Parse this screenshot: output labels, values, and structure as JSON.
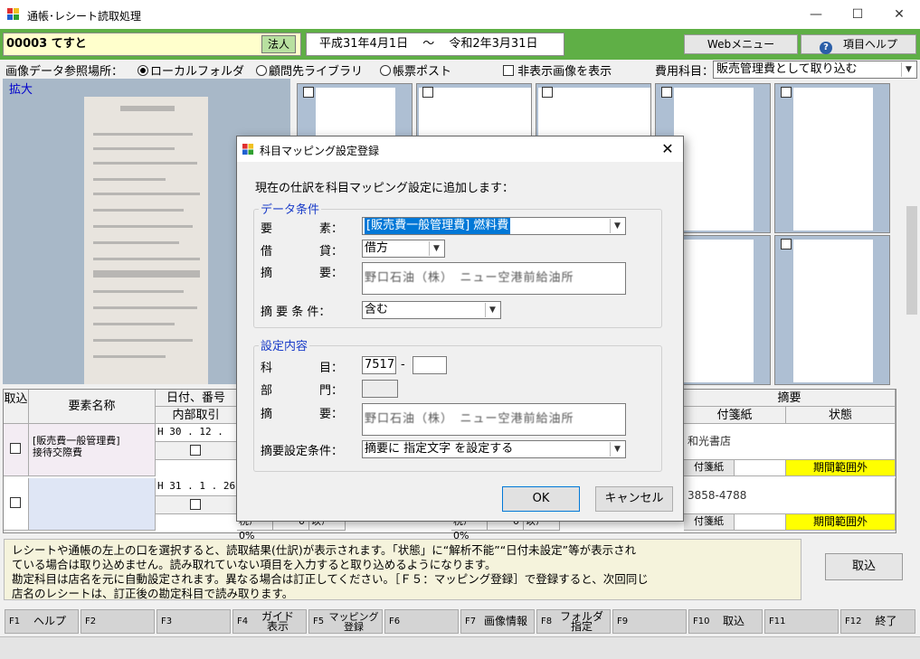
{
  "window": {
    "title": "通帳･レシート読取処理",
    "minimize": "—",
    "maximize": "☐",
    "close": "✕"
  },
  "header": {
    "company": "00003 てすと",
    "company_type": "法人",
    "period_start": "平成31年4月1日",
    "period_sep": "〜",
    "period_end": "令和2年3月31日",
    "web_menu": "Webメニュー",
    "help_label": "項目ヘルプ"
  },
  "options": {
    "source_label": "画像データ参照場所：",
    "sources": [
      "ローカルフォルダ",
      "顧問先ライブラリ",
      "帳票ポスト"
    ],
    "selected_source": 0,
    "hidden_images_label": "非表示画像を表示",
    "cost_label": "費用科目：",
    "cost_value": "販売管理費として取り込む"
  },
  "zoom": {
    "label": "拡大"
  },
  "grid": {
    "headers": {
      "import": "取込",
      "element": "要素名称",
      "date": "日付、番号",
      "internal": "内部取引",
      "summary": "摘要",
      "sticky": "付箋紙",
      "status": "状態"
    },
    "rows": [
      {
        "element": "[販売費一般管理費]\n接待交際費",
        "date": "H 30 . 12 . 24",
        "summary_partial": "和光書店",
        "sticky": "付箋紙",
        "status": "期間範囲外",
        "tax1": "税ｱ 0%",
        "tax_val1": "0",
        "tax_kind1": "以ｱ",
        "tax2": "税ｱ 0%",
        "tax_val2": "0",
        "tax_kind2": "以ｱ"
      },
      {
        "element": "",
        "date": "H 31 .  1 . 26",
        "summary_partial": "3858-4788",
        "sticky": "付箋紙",
        "status": "期間範囲外",
        "tax1": "税ｱ 0%",
        "tax_val1": "0",
        "tax_kind1": "以ｱ",
        "tax2": "税ｱ 0%",
        "tax_val2": "0",
        "tax_kind2": "以ｱ"
      }
    ]
  },
  "message": {
    "line1": "レシートや通帳の左上の口を選択すると、読取結果(仕訳)が表示されます。「状態」に“解析不能”“日付未設定”等が表示され",
    "line2": "ている場合は取り込めません。読み取れていない項目を入力すると取り込めるようになります。",
    "line3": "勘定科目は店名を元に自動設定されます。異なる場合は訂正してください。［Ｆ５：マッピング登録］で登録すると、次回同じ",
    "line4": "店名のレシートは、訂正後の勘定科目で読み取ります。"
  },
  "import_button": "取込",
  "fkeys": [
    {
      "key": "F1",
      "label": "ヘルプ"
    },
    {
      "key": "F2",
      "label": ""
    },
    {
      "key": "F3",
      "label": ""
    },
    {
      "key": "F4",
      "label": "ガイド\n表示"
    },
    {
      "key": "F5",
      "label": "マッピング\n登録"
    },
    {
      "key": "F6",
      "label": ""
    },
    {
      "key": "F7",
      "label": "画像情報"
    },
    {
      "key": "F8",
      "label": "フォルダ\n指定"
    },
    {
      "key": "F9",
      "label": ""
    },
    {
      "key": "F10",
      "label": "取込"
    },
    {
      "key": "F11",
      "label": ""
    },
    {
      "key": "F12",
      "label": "終了"
    }
  ],
  "dialog": {
    "title": "科目マッピング設定登録",
    "close": "✕",
    "intro": "現在の仕訳を科目マッピング設定に追加します：",
    "group1": "データ条件",
    "element_label": "要　　　　素：",
    "element_value": "[販売費一般管理費] 燃料費",
    "debit_label": "借　　　　貸：",
    "debit_value": "借方",
    "summary_label": "摘　　　　要：",
    "summary_value": "野口石油（株）　ニュー空港前給油所",
    "cond_label": "摘 要 条 件：",
    "cond_value": "含む",
    "group2": "設定内容",
    "account_label": "科　　　　目：",
    "account_value": "7517",
    "account_dash": "-",
    "dept_label": "部　　　　門：",
    "summary2_label": "摘　　　　要：",
    "summary2_value": "野口石油（株）　ニュー空港前給油所",
    "setcond_label": "摘要設定条件：",
    "setcond_value": "摘要に 指定文字 を設定する",
    "ok": "OK",
    "cancel": "キャンセル"
  },
  "colors": {
    "header_green": "#5faf46",
    "company_bg": "#ffffcc",
    "status_yellow": "#ffff00",
    "group_title": "#1a3cc8",
    "selection": "#0078d7"
  }
}
